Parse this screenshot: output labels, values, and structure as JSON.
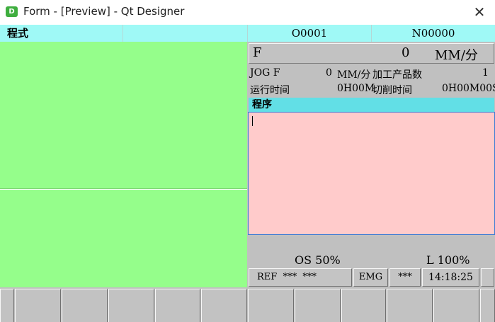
{
  "window": {
    "app_icon_letter": "D",
    "title": "Form - [Preview] - Qt Designer",
    "close_glyph": "✕"
  },
  "header": {
    "mode": "程式",
    "program_number": "O0001",
    "sequence_number": "N00000"
  },
  "feed": {
    "label": "F",
    "value": "0",
    "unit": "MM/分"
  },
  "info": {
    "jog_label": "JOG F",
    "jog_value": "0",
    "jog_unit": "MM/分",
    "parts_label": "加工产品数",
    "parts_value": "1",
    "run_time_label": "运行时间",
    "run_time_value": "0H00M",
    "cut_time_label": "切削时间",
    "cut_time_value": "0H00M00S"
  },
  "program": {
    "header": "程序"
  },
  "overrides": {
    "os": "OS 50%",
    "l": "L 100%"
  },
  "status_bar": {
    "ref": "REF  ***  ***",
    "emg": "EMG",
    "stars": "***",
    "clock": "14:18:25"
  },
  "colors": {
    "header_bg": "#9ff9f6",
    "left_panel": "#95fe8b",
    "program_header": "#62dfe6",
    "program_editor": "#ffcbcb",
    "panel_gray": "#c0c0c0"
  }
}
